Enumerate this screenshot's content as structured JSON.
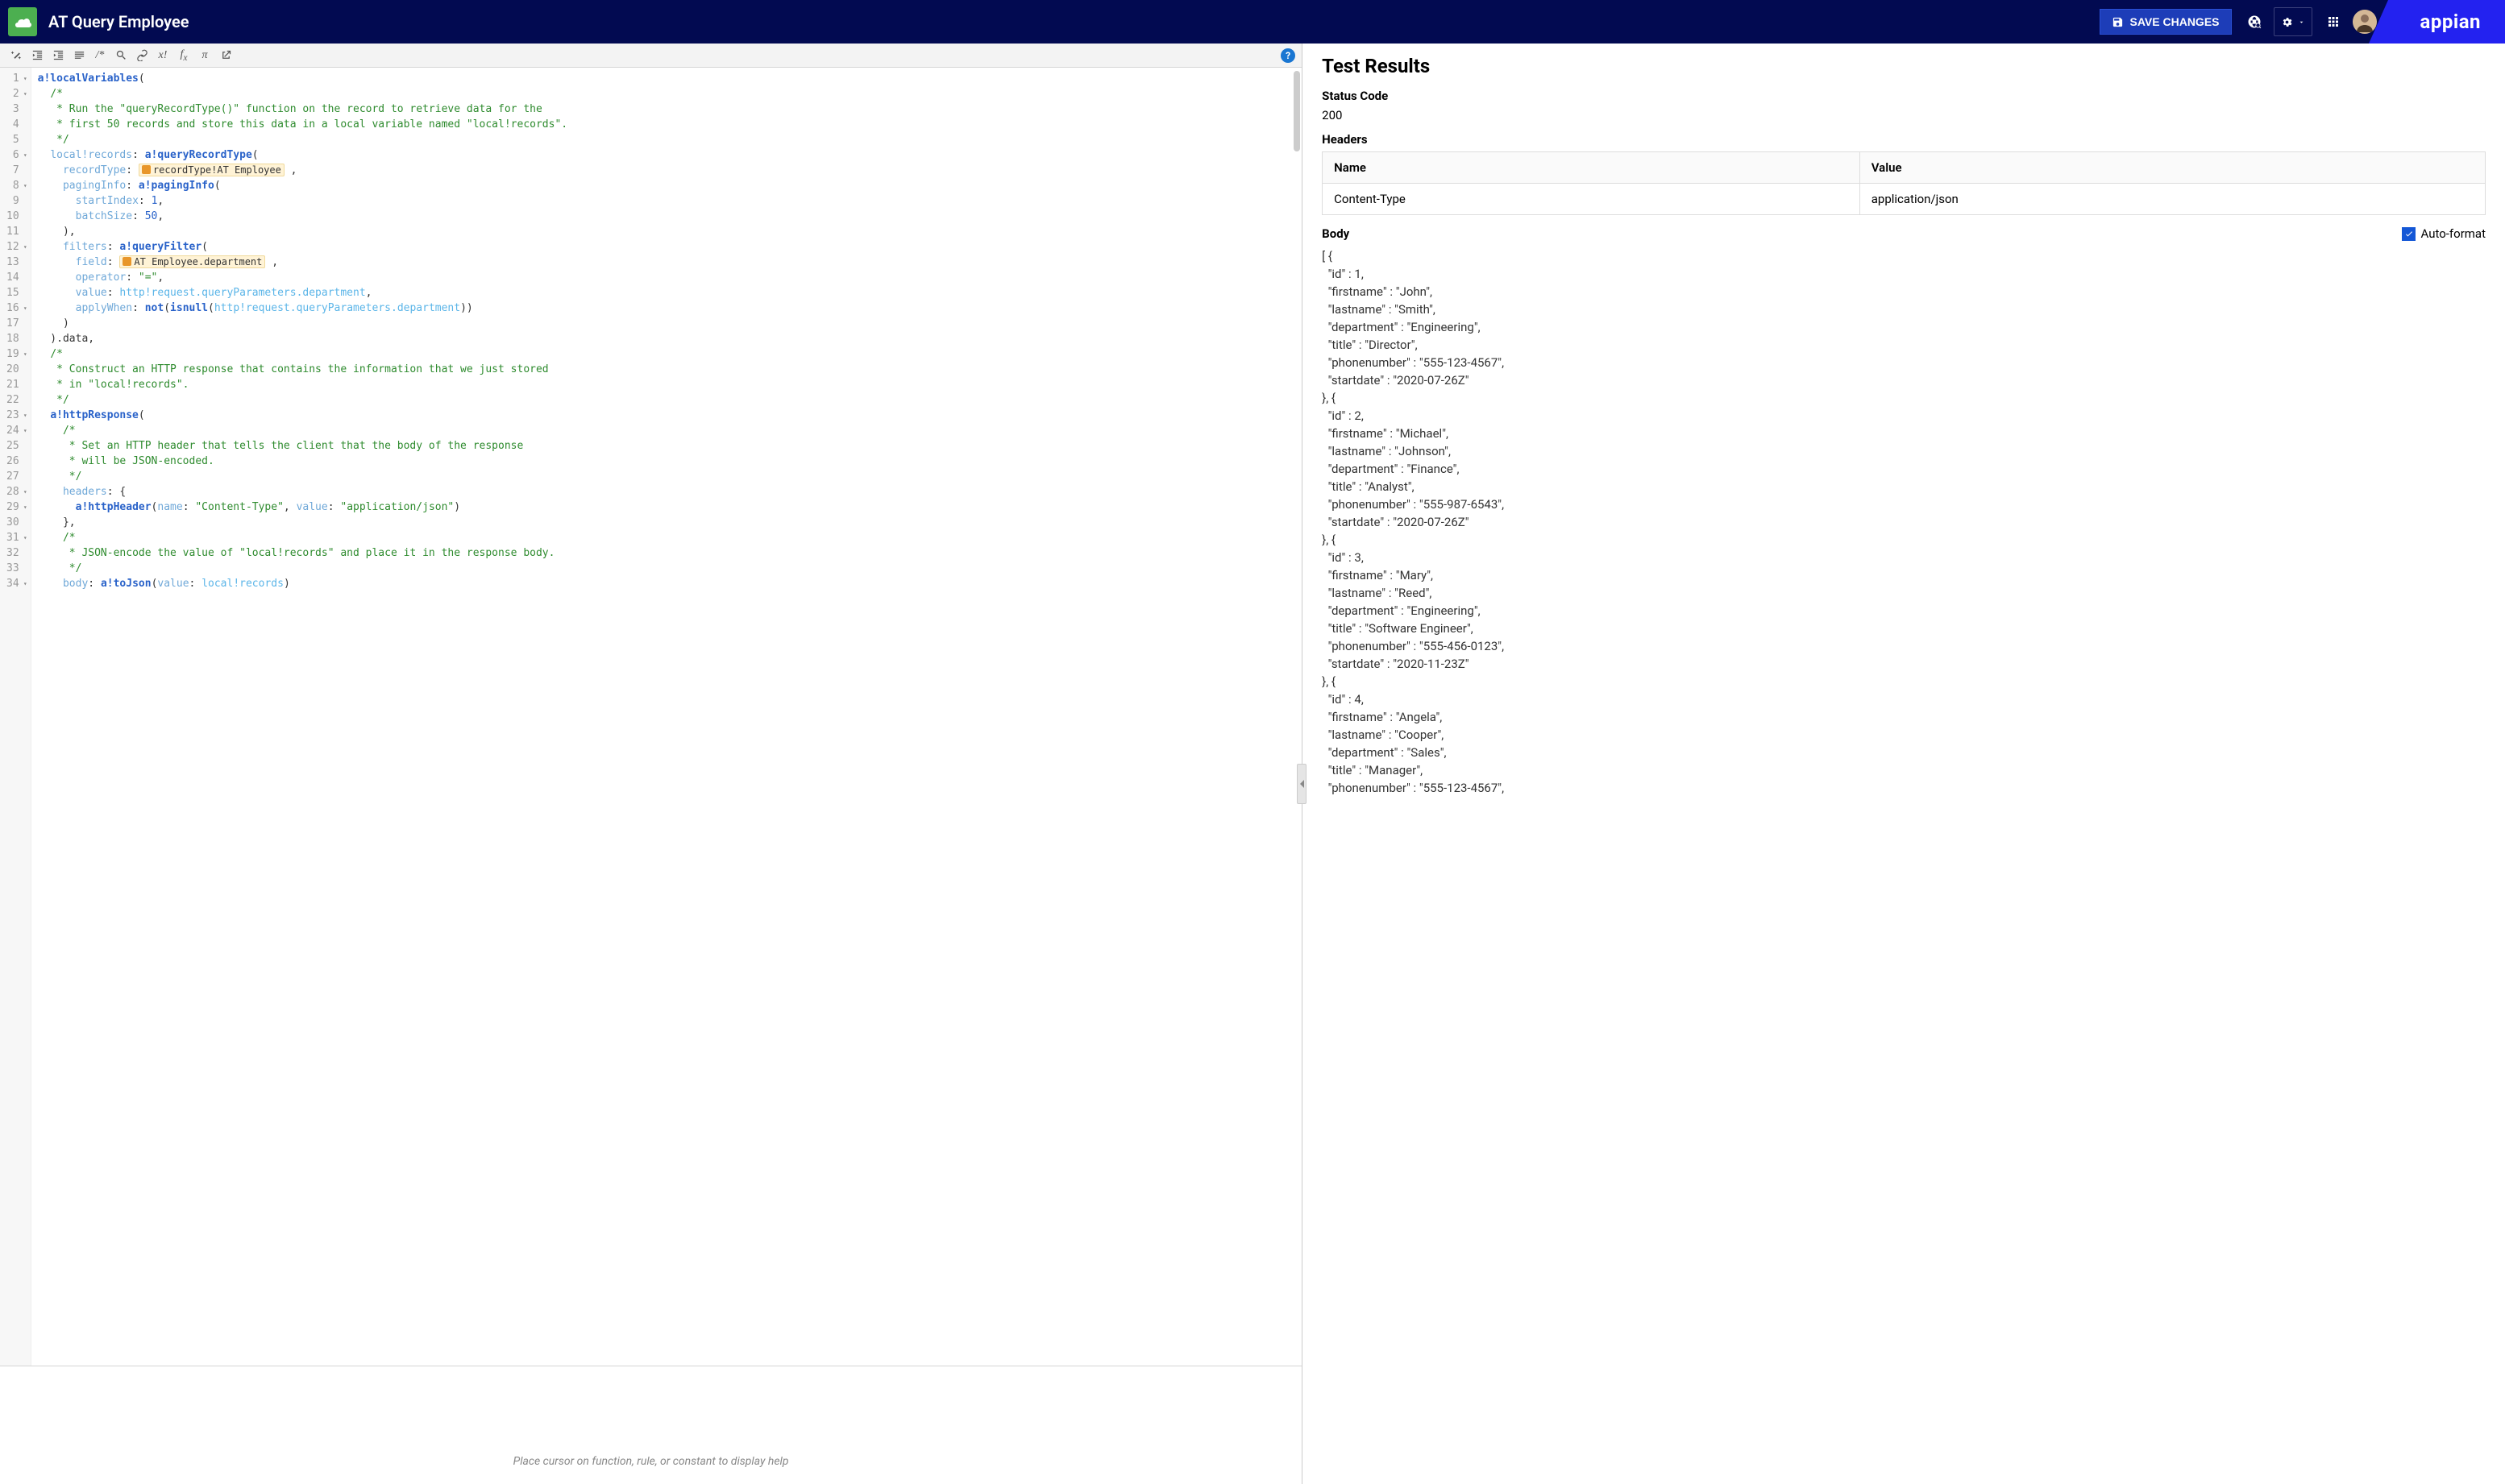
{
  "header": {
    "title": "AT Query Employee",
    "save_label": "SAVE CHANGES",
    "brand": "appian"
  },
  "toolbar": {
    "hint": "Place cursor on function, rule, or constant to display help"
  },
  "code": {
    "lines": [
      {
        "n": 1,
        "fold": true,
        "seg": [
          {
            "c": "tk-fn",
            "t": "a!localVariables"
          },
          {
            "t": "("
          }
        ]
      },
      {
        "n": 2,
        "fold": true,
        "seg": [
          {
            "t": "  "
          },
          {
            "c": "tk-com",
            "t": "/*"
          }
        ]
      },
      {
        "n": 3,
        "seg": [
          {
            "t": "   "
          },
          {
            "c": "tk-com",
            "t": "* Run the \"queryRecordType()\" function on the record to retrieve data for the"
          }
        ]
      },
      {
        "n": 4,
        "seg": [
          {
            "t": "   "
          },
          {
            "c": "tk-com",
            "t": "* first 50 records and store this data in a local variable named \"local!records\"."
          }
        ]
      },
      {
        "n": 5,
        "seg": [
          {
            "t": "   "
          },
          {
            "c": "tk-com",
            "t": "*/"
          }
        ]
      },
      {
        "n": 6,
        "fold": true,
        "seg": [
          {
            "t": "  "
          },
          {
            "c": "tk-key",
            "t": "local!records"
          },
          {
            "t": ": "
          },
          {
            "c": "tk-fn",
            "t": "a!queryRecordType"
          },
          {
            "t": "("
          }
        ]
      },
      {
        "n": 7,
        "seg": [
          {
            "t": "    "
          },
          {
            "c": "tk-key",
            "t": "recordType"
          },
          {
            "t": ": "
          },
          {
            "c": "tk-rec",
            "ico": true,
            "t": "recordType!AT Employee"
          },
          {
            "t": " ,"
          }
        ]
      },
      {
        "n": 8,
        "fold": true,
        "seg": [
          {
            "t": "    "
          },
          {
            "c": "tk-key",
            "t": "pagingInfo"
          },
          {
            "t": ": "
          },
          {
            "c": "tk-fn",
            "t": "a!pagingInfo"
          },
          {
            "t": "("
          }
        ]
      },
      {
        "n": 9,
        "seg": [
          {
            "t": "      "
          },
          {
            "c": "tk-key",
            "t": "startIndex"
          },
          {
            "t": ": "
          },
          {
            "c": "tk-num",
            "t": "1"
          },
          {
            "t": ","
          }
        ]
      },
      {
        "n": 10,
        "seg": [
          {
            "t": "      "
          },
          {
            "c": "tk-key",
            "t": "batchSize"
          },
          {
            "t": ": "
          },
          {
            "c": "tk-num",
            "t": "50"
          },
          {
            "t": ","
          }
        ]
      },
      {
        "n": 11,
        "seg": [
          {
            "t": "    ),"
          }
        ]
      },
      {
        "n": 12,
        "fold": true,
        "seg": [
          {
            "t": "    "
          },
          {
            "c": "tk-key",
            "t": "filters"
          },
          {
            "t": ": "
          },
          {
            "c": "tk-fn",
            "t": "a!queryFilter"
          },
          {
            "t": "("
          }
        ]
      },
      {
        "n": 13,
        "seg": [
          {
            "t": "      "
          },
          {
            "c": "tk-key",
            "t": "field"
          },
          {
            "t": ": "
          },
          {
            "c": "tk-rec",
            "ico": true,
            "t": "AT Employee.department"
          },
          {
            "t": " ,"
          }
        ]
      },
      {
        "n": 14,
        "seg": [
          {
            "t": "      "
          },
          {
            "c": "tk-key",
            "t": "operator"
          },
          {
            "t": ": "
          },
          {
            "c": "tk-str",
            "t": "\"=\""
          },
          {
            "t": ","
          }
        ]
      },
      {
        "n": 15,
        "seg": [
          {
            "t": "      "
          },
          {
            "c": "tk-key",
            "t": "value"
          },
          {
            "t": ": "
          },
          {
            "c": "tk-link",
            "t": "http!request.queryParameters.department"
          },
          {
            "t": ","
          }
        ]
      },
      {
        "n": 16,
        "fold": true,
        "seg": [
          {
            "t": "      "
          },
          {
            "c": "tk-key",
            "t": "applyWhen"
          },
          {
            "t": ": "
          },
          {
            "c": "tk-fn",
            "t": "not"
          },
          {
            "t": "("
          },
          {
            "c": "tk-fn",
            "t": "isnull"
          },
          {
            "t": "("
          },
          {
            "c": "tk-link",
            "t": "http!request.queryParameters.department"
          },
          {
            "t": "))"
          }
        ]
      },
      {
        "n": 17,
        "seg": [
          {
            "t": "    )"
          }
        ]
      },
      {
        "n": 18,
        "seg": [
          {
            "t": "  ).data,"
          }
        ]
      },
      {
        "n": 19,
        "fold": true,
        "seg": [
          {
            "t": "  "
          },
          {
            "c": "tk-com",
            "t": "/*"
          }
        ]
      },
      {
        "n": 20,
        "seg": [
          {
            "t": "   "
          },
          {
            "c": "tk-com",
            "t": "* Construct an HTTP response that contains the information that we just stored"
          }
        ]
      },
      {
        "n": 21,
        "seg": [
          {
            "t": "   "
          },
          {
            "c": "tk-com",
            "t": "* in \"local!records\"."
          }
        ]
      },
      {
        "n": 22,
        "seg": [
          {
            "t": "   "
          },
          {
            "c": "tk-com",
            "t": "*/"
          }
        ]
      },
      {
        "n": 23,
        "fold": true,
        "seg": [
          {
            "t": "  "
          },
          {
            "c": "tk-fn",
            "t": "a!httpResponse"
          },
          {
            "t": "("
          }
        ]
      },
      {
        "n": 24,
        "fold": true,
        "seg": [
          {
            "t": "    "
          },
          {
            "c": "tk-com",
            "t": "/*"
          }
        ]
      },
      {
        "n": 25,
        "seg": [
          {
            "t": "     "
          },
          {
            "c": "tk-com",
            "t": "* Set an HTTP header that tells the client that the body of the response"
          }
        ]
      },
      {
        "n": 26,
        "seg": [
          {
            "t": "     "
          },
          {
            "c": "tk-com",
            "t": "* will be JSON-encoded."
          }
        ]
      },
      {
        "n": 27,
        "seg": [
          {
            "t": "     "
          },
          {
            "c": "tk-com",
            "t": "*/"
          }
        ]
      },
      {
        "n": 28,
        "fold": true,
        "seg": [
          {
            "t": "    "
          },
          {
            "c": "tk-key",
            "t": "headers"
          },
          {
            "t": ": {"
          }
        ]
      },
      {
        "n": 29,
        "fold": true,
        "seg": [
          {
            "t": "      "
          },
          {
            "c": "tk-fn",
            "t": "a!httpHeader"
          },
          {
            "t": "("
          },
          {
            "c": "tk-key",
            "t": "name"
          },
          {
            "t": ": "
          },
          {
            "c": "tk-str",
            "t": "\"Content-Type\""
          },
          {
            "t": ", "
          },
          {
            "c": "tk-key",
            "t": "value"
          },
          {
            "t": ": "
          },
          {
            "c": "tk-str",
            "t": "\"application/json\""
          },
          {
            "t": ")"
          }
        ]
      },
      {
        "n": 30,
        "seg": [
          {
            "t": "    },"
          }
        ]
      },
      {
        "n": 31,
        "fold": true,
        "seg": [
          {
            "t": "    "
          },
          {
            "c": "tk-com",
            "t": "/*"
          }
        ]
      },
      {
        "n": 32,
        "seg": [
          {
            "t": "     "
          },
          {
            "c": "tk-com",
            "t": "* JSON-encode the value of \"local!records\" and place it in the response body."
          }
        ]
      },
      {
        "n": 33,
        "seg": [
          {
            "t": "     "
          },
          {
            "c": "tk-com",
            "t": "*/"
          }
        ]
      },
      {
        "n": 34,
        "fold": true,
        "seg": [
          {
            "t": "    "
          },
          {
            "c": "tk-key",
            "t": "body"
          },
          {
            "t": ": "
          },
          {
            "c": "tk-fn",
            "t": "a!toJson"
          },
          {
            "t": "("
          },
          {
            "c": "tk-key",
            "t": "value"
          },
          {
            "t": ": "
          },
          {
            "c": "tk-link",
            "t": "local!records"
          },
          {
            "t": ")"
          }
        ]
      }
    ]
  },
  "results": {
    "title": "Test Results",
    "status_label": "Status Code",
    "status_value": "200",
    "headers_label": "Headers",
    "headers_cols": {
      "name": "Name",
      "value": "Value"
    },
    "headers_rows": [
      {
        "name": "Content-Type",
        "value": "application/json"
      }
    ],
    "body_label": "Body",
    "autoformat_label": "Auto-format",
    "body_json": "[ {\n  \"id\" : 1,\n  \"firstname\" : \"John\",\n  \"lastname\" : \"Smith\",\n  \"department\" : \"Engineering\",\n  \"title\" : \"Director\",\n  \"phonenumber\" : \"555-123-4567\",\n  \"startdate\" : \"2020-07-26Z\"\n}, {\n  \"id\" : 2,\n  \"firstname\" : \"Michael\",\n  \"lastname\" : \"Johnson\",\n  \"department\" : \"Finance\",\n  \"title\" : \"Analyst\",\n  \"phonenumber\" : \"555-987-6543\",\n  \"startdate\" : \"2020-07-26Z\"\n}, {\n  \"id\" : 3,\n  \"firstname\" : \"Mary\",\n  \"lastname\" : \"Reed\",\n  \"department\" : \"Engineering\",\n  \"title\" : \"Software Engineer\",\n  \"phonenumber\" : \"555-456-0123\",\n  \"startdate\" : \"2020-11-23Z\"\n}, {\n  \"id\" : 4,\n  \"firstname\" : \"Angela\",\n  \"lastname\" : \"Cooper\",\n  \"department\" : \"Sales\",\n  \"title\" : \"Manager\",\n  \"phonenumber\" : \"555-123-4567\","
  }
}
